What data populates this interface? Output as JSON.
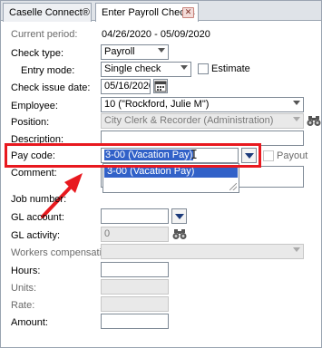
{
  "tabs": [
    {
      "label": "Caselle Connect®"
    },
    {
      "label": "Enter Payroll Checks"
    }
  ],
  "icons": {
    "tab_close": "close-icon",
    "calendar": "calendar-icon",
    "lookup": "binoculars-icon"
  },
  "form": {
    "current_period_label": "Current period:",
    "current_period_value": "04/26/2020 - 05/09/2020",
    "check_type_label": "Check type:",
    "check_type_value": "Payroll",
    "entry_mode_label": "Entry mode:",
    "entry_mode_value": "Single check",
    "estimate_label": "Estimate",
    "check_issue_date_label": "Check issue date:",
    "check_issue_date_value": "05/16/2020",
    "employee_label": "Employee:",
    "employee_value": "10 (\"Rockford, Julie M\")",
    "position_label": "Position:",
    "position_value": "City Clerk & Recorder (Administration)",
    "description_label": "Description:",
    "description_value": "",
    "pay_code_label": "Pay code:",
    "pay_code_value": "3-00 (Vacation Pay)",
    "payout_label": "Payout",
    "pay_code_options": [
      "3-00 (Vacation Pay)"
    ],
    "comment_label": "Comment:",
    "job_number_label": "Job number:",
    "gl_account_label": "GL account:",
    "gl_activity_label": "GL activity:",
    "gl_activity_value": "0",
    "workers_comp_label": "Workers compensation:",
    "hours_label": "Hours:",
    "units_label": "Units:",
    "rate_label": "Rate:",
    "amount_label": "Amount:"
  },
  "colors": {
    "highlight": "#e8191f",
    "selection": "#3161c8"
  }
}
